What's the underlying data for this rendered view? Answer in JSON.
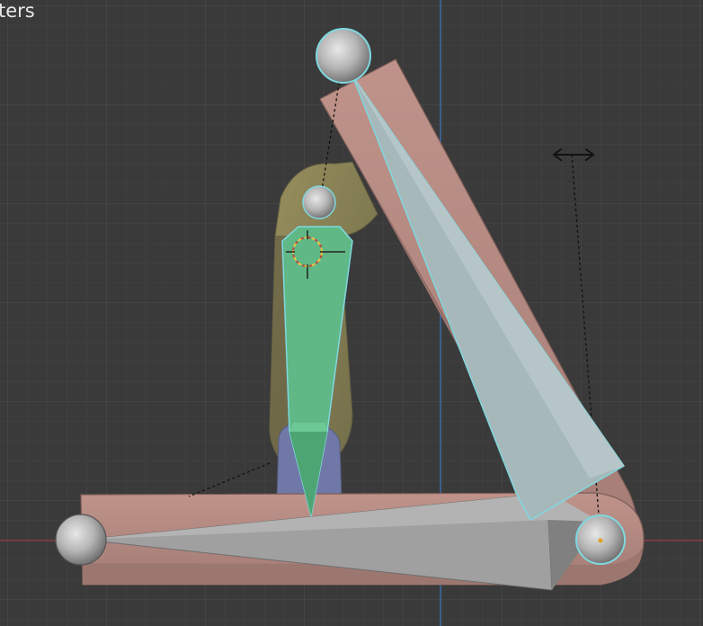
{
  "viewport": {
    "overlay_text": "ters",
    "colors": {
      "background": "#3a3a3a",
      "grid_minor": "#444444",
      "grid_major": "#4d4d4d",
      "axis_x": "#8a3a46",
      "axis_y": "#3a6aa8",
      "mesh_skin": "#b58a82",
      "mesh_skin_dark": "#8e6a64",
      "mesh_olive": "#8a8252",
      "mesh_blue": "#6f78a6",
      "bone_gray": "#9b9b9b",
      "bone_selected": "#a6b8ba",
      "bone_active": "#5fb886",
      "select_outline": "#7fd8e0",
      "cursor_ring": "#e6c048"
    },
    "icons": [
      "3d-cursor-icon",
      "move-arrows-icon"
    ]
  }
}
